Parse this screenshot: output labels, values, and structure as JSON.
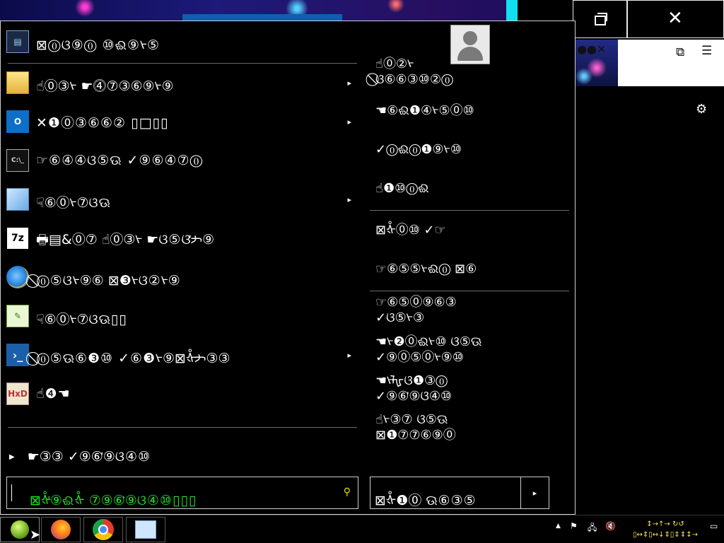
{
  "desktop": {
    "browser_tab_glyphs": "●●✕",
    "extensions_icon": "puzzle-icon",
    "menu_icon": "hamburger-menu-icon",
    "settings_icon": "gear-icon"
  },
  "window_controls": {
    "restore_icon": "restore-icon",
    "close_label": "✕"
  },
  "start_menu": {
    "user_avatar": "user-avatar-icon",
    "programs": [
      {
        "label": "⊠⓪ଓ⑨⓪  ⑩ଈ⑨ᢣ⑤",
        "icon": "console-icon",
        "arrow": ""
      },
      {
        "label": "☝⓪③ᢣ  ☛⓸⑦③⑥⑨ᢣ⑨",
        "icon": "folder-icon",
        "arrow": "▸"
      },
      {
        "label": "✕❶⓪③⑥⑥②  ▯□▯▯",
        "icon": "outlook-icon",
        "arrow": "▸"
      },
      {
        "label": "☞⑥④④ଓ⑤ଊ  ✓⑨⑥④⑦⓪",
        "icon": "terminal-icon",
        "arrow": ""
      },
      {
        "label": "☟⑥⓪ᢣ⑦ଓଊ",
        "icon": "notepad-icon",
        "arrow": "▸"
      },
      {
        "label": "🖶▤&⓪⑦  ☝⓪③ᢣ  ☛ଓ⑤ଓᡃᢣ⑨",
        "icon": "7zip-icon",
        "arrow": ""
      },
      {
        "label": "⃠⓪⑤ଓᢣ⑨⑥  ⊠❸ᢣଓ②ᢣ⑨",
        "icon": "ie-icon",
        "arrow": ""
      },
      {
        "label": "☟⑥⓪ᢣ⑦ଓଊ▯▯",
        "icon": "notepadpp-icon",
        "arrow": ""
      },
      {
        "label": "⃠⓪⑤ଊ⑥❸⑩  ✓⑥❸ᢣ⑨⊠ᢤᢣ③③",
        "icon": "powershell-icon",
        "arrow": "▸"
      },
      {
        "label": "☝❹☚",
        "icon": "hxd-icon",
        "arrow": ""
      }
    ],
    "all_programs": "☛③③  ✓⑨⑥ᡃ⑨ଓ④⑩",
    "search_value": "⊠ᢤᡃ⑨ଈᢤ  ⑦⑨⑥ᡃ⑨ଓ④⑩▯▯▯",
    "search_icon": "search-icon",
    "right_links": [
      {
        "line1": "☝⓪②ᢣ",
        "line2": "⃠ଓ⑥⑥③⑩②⓪"
      },
      {
        "line1": "☚⑥ଈ❶④ᢣ⑤⓪⑩",
        "line2": ""
      },
      {
        "line1": "✓⓪ଈ⓪❶⑨ᢣ⑩",
        "line2": ""
      },
      {
        "line1": "☝❶⑩⓪ଈ",
        "line2": ""
      },
      {
        "line1": "⊠ᢤ⓪⑩  ✓☞",
        "line2": ""
      },
      {
        "line1": "☞⑥⑤⑤ᢣଈ⓪  ⊠⑥",
        "line2": ""
      },
      {
        "line1": "☞⑥⑤⓪⑨⑥③",
        "line2": "✓ଓ⑤ᢣ③"
      },
      {
        "line1": "☚ᢣ❷⓪ଈᢣ⑩  ଓ⑤ଊ",
        "line2": "✓⑨⓪⑤⓪ᢣ⑨⑩"
      },
      {
        "line1": "☚ᢣᡀଓ❶③⓪",
        "line2": "✓⑨⑥ᡃ⑨ଓ④⑩"
      },
      {
        "line1": "☝ᢣ③⑦  ଓ⑤ଊ",
        "line2": "⊠❶⑦⑦⑥⑨⓪"
      }
    ],
    "power_label": "⊠ᢤ❶⓪  ଊ⑥③⑤",
    "power_arrow": "▸"
  },
  "taskbar": {
    "apps": [
      "start-orb",
      "firefox",
      "chrome",
      "control-panel"
    ],
    "tray_icons": [
      "show-hidden-icon",
      "flag-icon",
      "network-icon",
      "volume-muted-icon"
    ],
    "clock_line1": "↕→↑→  ↻↺",
    "clock_line2": "▯↔⇕▯↔↓⇕▯⇕⇕↕→"
  }
}
